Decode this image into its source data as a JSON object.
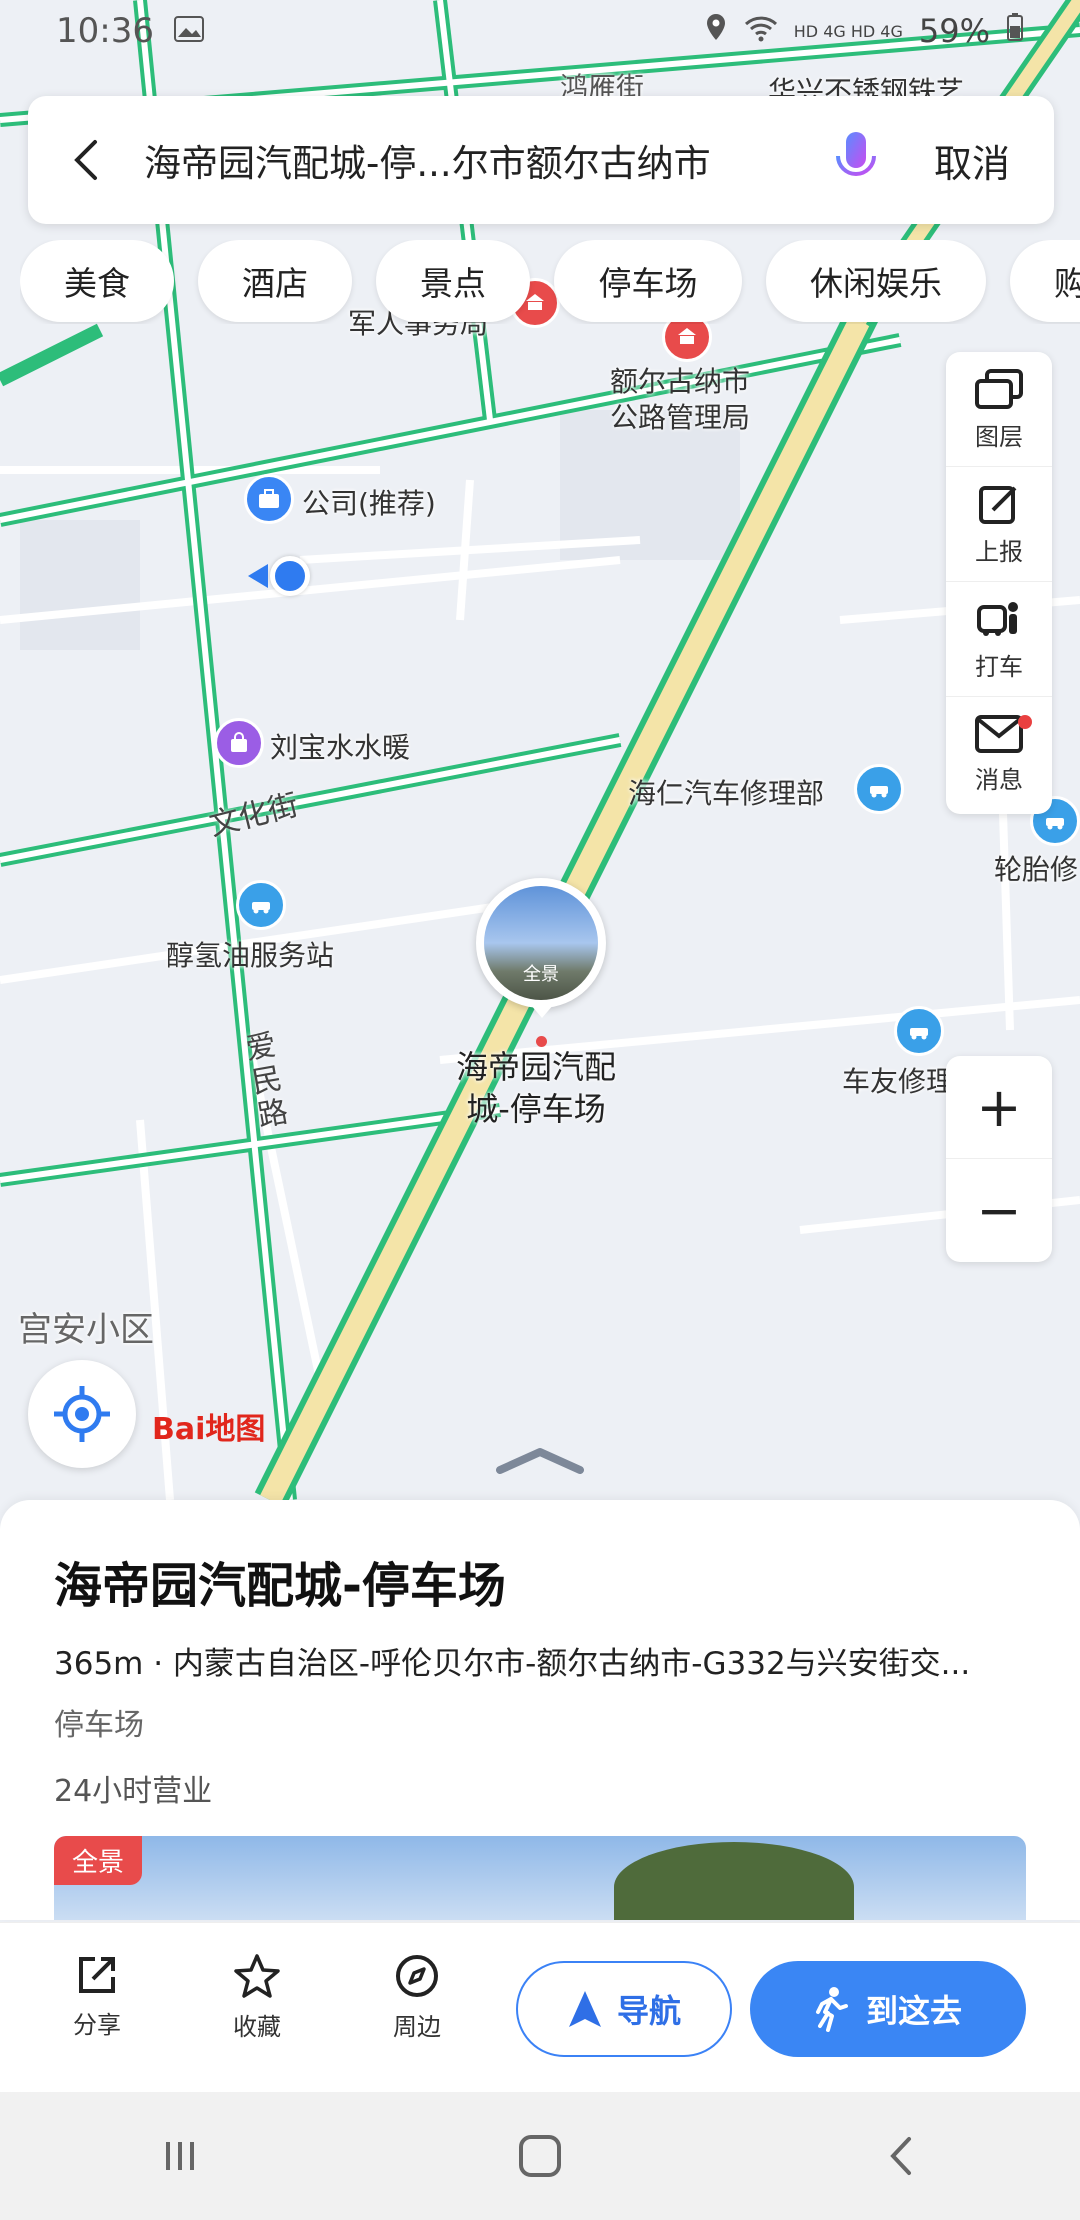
{
  "status_bar": {
    "time": "10:36",
    "network": "HD 4G HD 4G",
    "battery": "59%"
  },
  "search": {
    "query": "海帝园汽配城-停...尔市额尔古纳市",
    "cancel_label": "取消"
  },
  "chips": [
    "美食",
    "酒店",
    "景点",
    "停车场",
    "休闲娱乐",
    "购"
  ],
  "map": {
    "pois": [
      {
        "label": "额尔古纳市\n公路管理局"
      },
      {
        "label": "公司(推荐)"
      },
      {
        "label": "刘宝水水暖"
      },
      {
        "label": "海仁汽车修理部"
      },
      {
        "label": "轮胎修"
      },
      {
        "label": "醇氢油服务站"
      },
      {
        "label": "车友修理"
      },
      {
        "label": "宫安小区"
      },
      {
        "label": "军人事务局"
      },
      {
        "label": "华兴不锈钢铁艺"
      },
      {
        "label": "鸿雁街"
      }
    ],
    "road_labels": [
      "文化街",
      "爱民路"
    ],
    "selected_marker": {
      "name_line1": "海帝园汽配",
      "name_line2": "城-停车场",
      "panorama_label": "全景"
    },
    "logo_text": "Bai地图"
  },
  "side_tools": [
    {
      "icon": "layers-icon",
      "label": "图层"
    },
    {
      "icon": "report-icon",
      "label": "上报"
    },
    {
      "icon": "taxi-icon",
      "label": "打车"
    },
    {
      "icon": "message-icon",
      "label": "消息"
    }
  ],
  "zoom": {
    "plus": "+",
    "minus": "−"
  },
  "place": {
    "title": "海帝园汽配城-停车场",
    "address": "365m · 内蒙古自治区-呼伦贝尔市-额尔古纳市-G332与兴安街交...",
    "category": "停车场",
    "hours": "24小时营业",
    "photo_badge": "全景"
  },
  "actions": {
    "share": "分享",
    "favorite": "收藏",
    "nearby": "周边",
    "navigate": "导航",
    "go_here": "到这去"
  },
  "colors": {
    "accent": "#3a86f4",
    "road_green": "#2dbd7a",
    "highway_yellow": "#f4e4a8",
    "poi_red": "#e84b4b"
  }
}
